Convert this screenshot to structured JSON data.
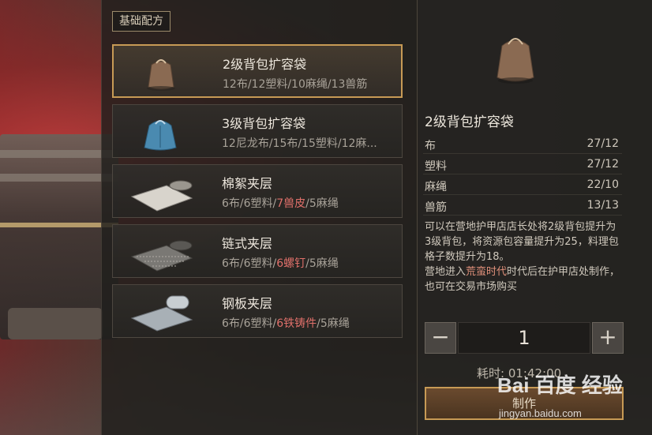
{
  "section_tag": "基础配方",
  "recipes": [
    {
      "name": "2级背包扩容袋",
      "mats": [
        "12布/12塑料/10麻绳/13兽筋"
      ],
      "icon": "brown-bag-icon"
    },
    {
      "name": "3级背包扩容袋",
      "mats": [
        "12尼龙布/15布/15塑料/12麻..."
      ],
      "icon": "blue-bag-icon"
    },
    {
      "name": "棉絮夹层",
      "mats_a": "6布/6塑料/",
      "mats_red": "7兽皮",
      "mats_b": "/5麻绳",
      "icon": "cotton-layer-icon"
    },
    {
      "name": "链式夹层",
      "mats_a": "6布/6塑料/",
      "mats_red": "6螺钉",
      "mats_b": "/5麻绳",
      "icon": "chain-layer-icon"
    },
    {
      "name": "钢板夹层",
      "mats_a": "6布/6塑料/",
      "mats_red": "6铁铸件",
      "mats_b": "/5麻绳",
      "icon": "steel-plate-icon"
    }
  ],
  "detail": {
    "title": "2级背包扩容袋",
    "icon": "brown-bag-icon",
    "stats": [
      {
        "label": "布",
        "value": "27/12"
      },
      {
        "label": "塑料",
        "value": "27/12"
      },
      {
        "label": "麻绳",
        "value": "22/10"
      },
      {
        "label": "兽筋",
        "value": "13/13"
      }
    ],
    "desc_main": "可以在营地护甲店店长处将2级背包提升为3级背包，将资源包容量提升为25，料理包格子数提升为18。",
    "desc_pre": "营地进入",
    "desc_hl": "荒蛮时代",
    "desc_post": "时代后在护甲店处制作，也可在交易市场购买"
  },
  "stepper": {
    "minus": "−",
    "value": "1",
    "plus": "+"
  },
  "time_label": "耗时: 01:42:00",
  "craft_label": "制作",
  "watermark": {
    "logo": "Bai 百度 经验",
    "url": "jingyan.baidu.com"
  },
  "colors": {
    "accent": "#c79a55",
    "highlight_red": "#e0706a",
    "panel": "#242220"
  }
}
